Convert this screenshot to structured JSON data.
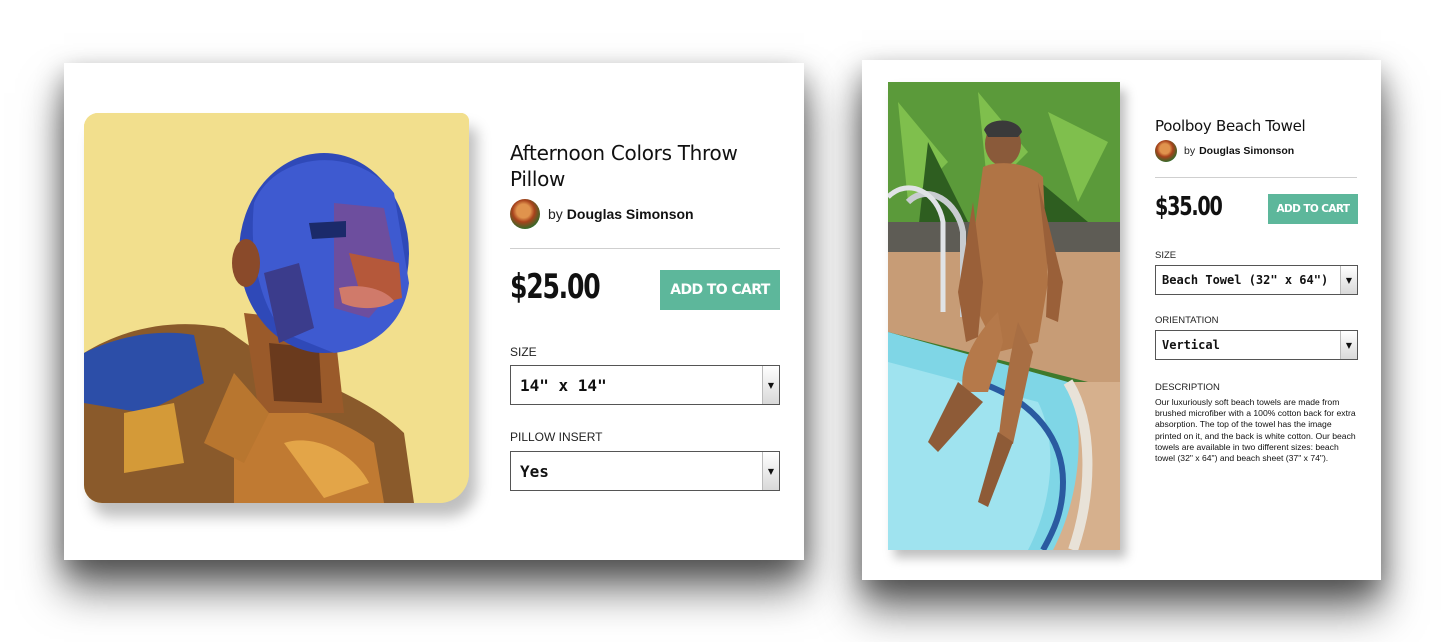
{
  "products": [
    {
      "title": "Afternoon Colors Throw Pillow",
      "artist_prefix": "by",
      "artist_name": "Douglas Simonson",
      "price": "$25.00",
      "add_to_cart_label": "ADD TO CART",
      "options": [
        {
          "label": "SIZE",
          "selected": "14\" x 14\""
        },
        {
          "label": "PILLOW INSERT",
          "selected": "Yes"
        }
      ]
    },
    {
      "title": "Poolboy Beach Towel",
      "artist_prefix": "by",
      "artist_name": "Douglas Simonson",
      "price": "$35.00",
      "add_to_cart_label": "ADD TO CART",
      "options": [
        {
          "label": "SIZE",
          "selected": "Beach Towel (32\" x 64\")"
        },
        {
          "label": "ORIENTATION",
          "selected": "Vertical"
        }
      ],
      "description_label": "DESCRIPTION",
      "description": "Our luxuriously soft beach towels are made from brushed microfiber with a 100% cotton back for extra absorption.   The top of the towel has the image printed on it, and the back is white cotton.   Our beach towels are available in two different sizes: beach towel (32\" x 64\") and beach sheet (37\" x 74\")."
    }
  ],
  "colors": {
    "accent_button": "#5db79b",
    "pillow_background": "#f2df8d",
    "pool_water": "#7fd6e6"
  },
  "icons": {
    "select_caret": "caret-down-icon"
  }
}
